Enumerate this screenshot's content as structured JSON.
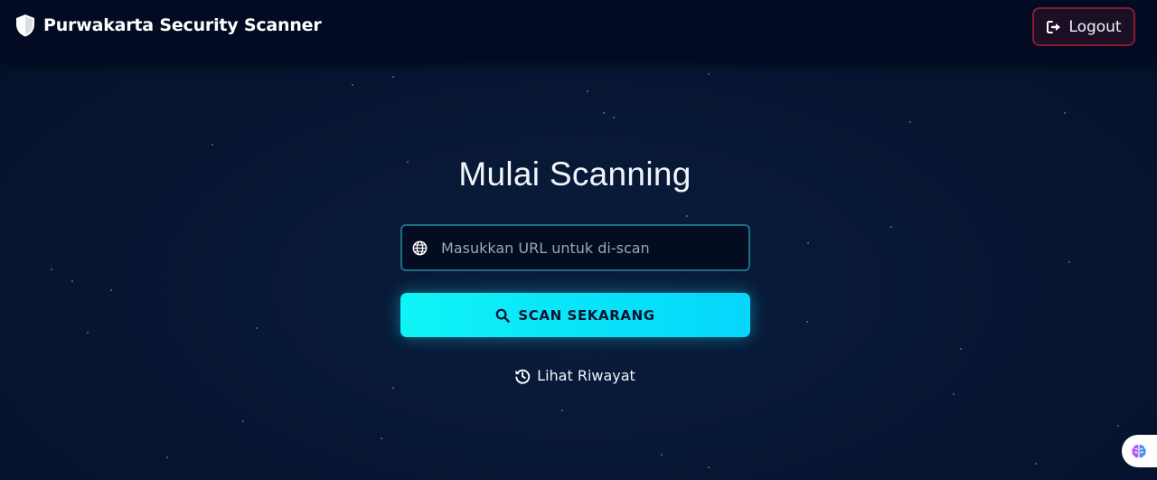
{
  "header": {
    "brand_title": "Purwakarta Security Scanner",
    "brand_icon": "shield-icon",
    "logout_label": "Logout",
    "logout_icon": "sign-out-icon"
  },
  "main": {
    "title": "Mulai Scanning",
    "url_input": {
      "placeholder": "Masukkan URL untuk di-scan",
      "value": "",
      "icon": "globe-icon"
    },
    "scan_button": {
      "label": "SCAN SEKARANG",
      "icon": "search-icon"
    },
    "history_link": {
      "label": "Lihat Riwayat",
      "icon": "history-icon"
    }
  },
  "floating": {
    "assistant_icon": "brain-icon"
  },
  "colors": {
    "background": "#04112b",
    "navbar": "#020b21",
    "accent_cyan": "#08e2f9",
    "logout_border": "#8a1a34",
    "input_border": "#1d6f84"
  }
}
